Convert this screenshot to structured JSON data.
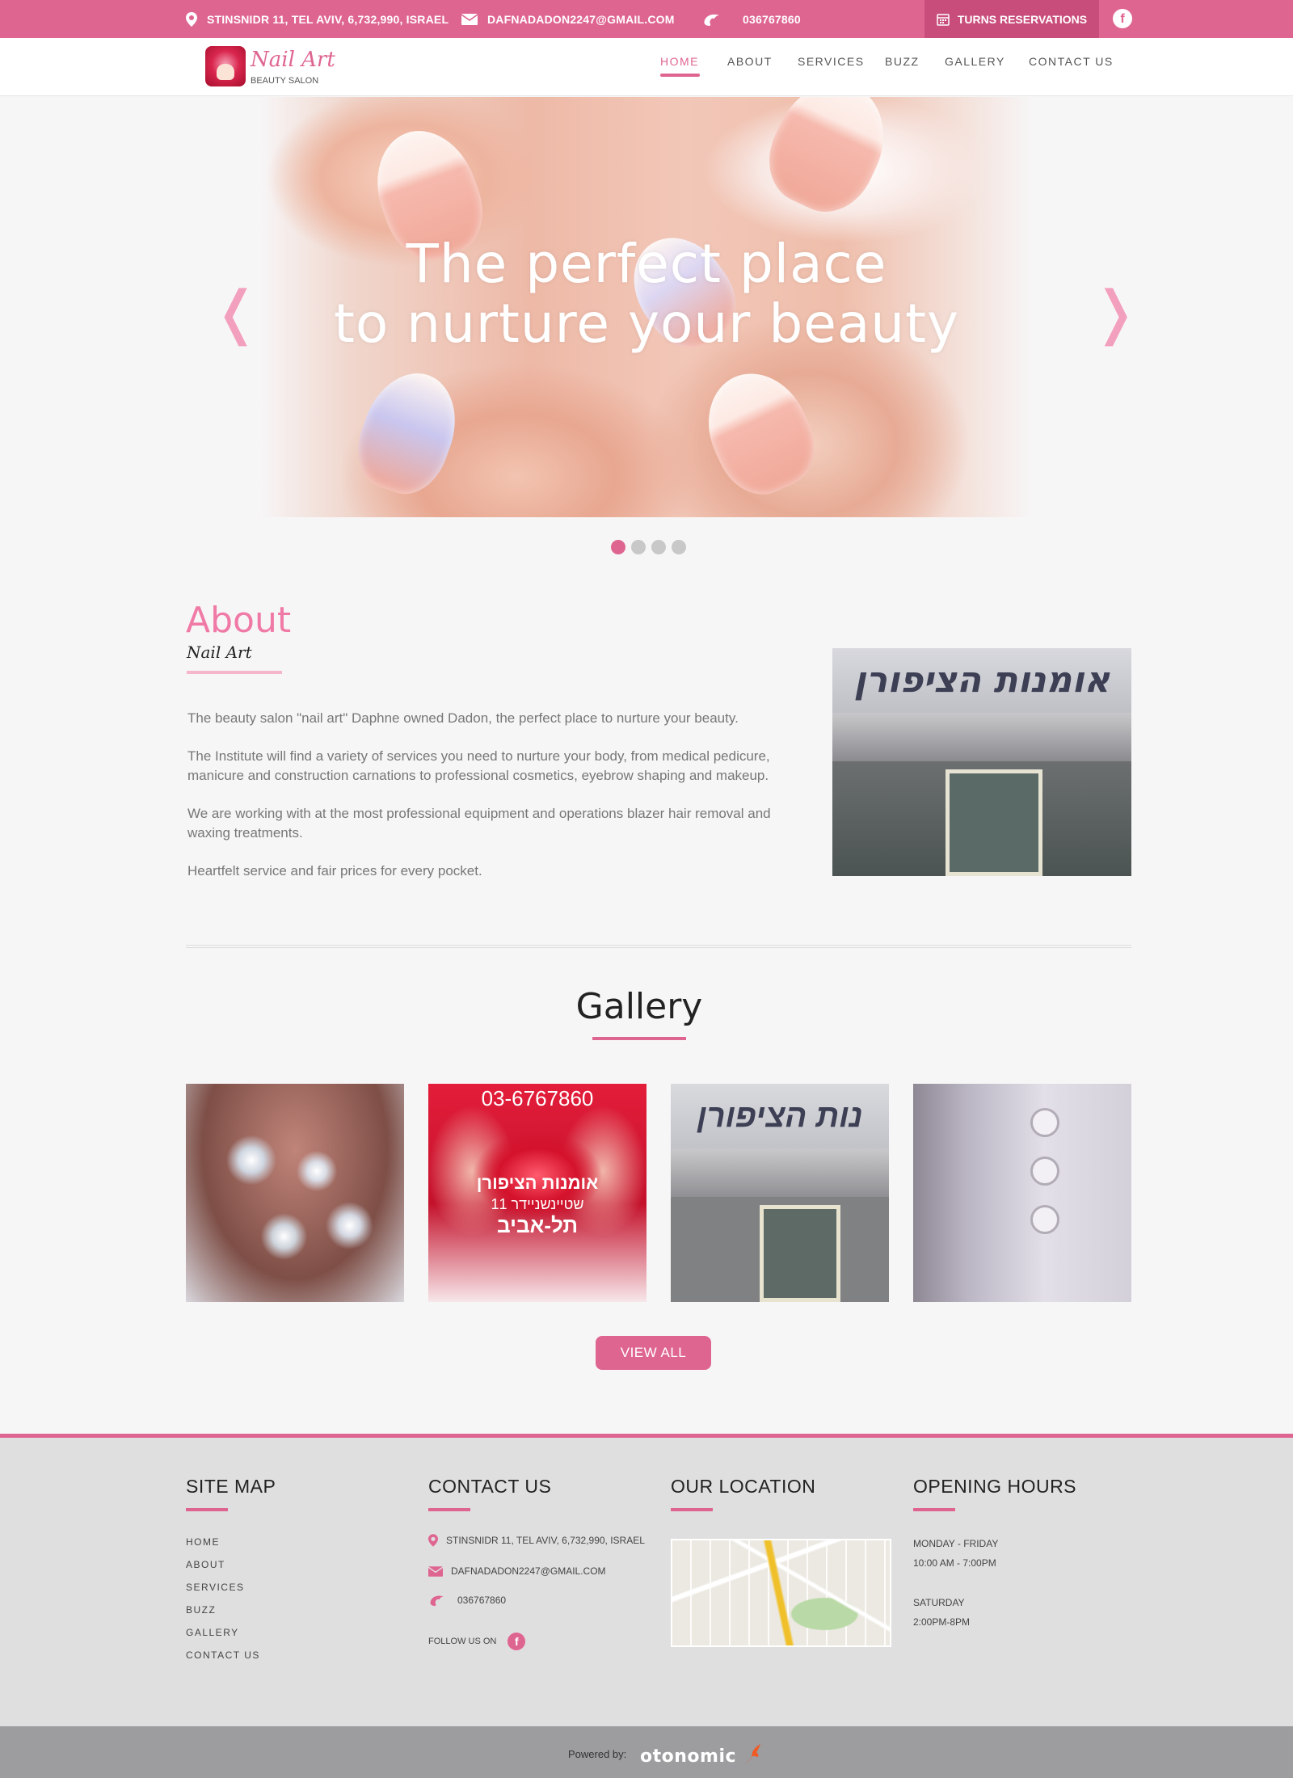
{
  "topbar": {
    "address": "STINSNIDR 11, TEL AVIV, 6,732,990, ISRAEL",
    "email": "DAFNADADON2247@GMAIL.COM",
    "phone": "036767860",
    "reserve_label": "TURNS RESERVATIONS",
    "facebook_glyph": "f"
  },
  "header": {
    "logo_name": "Nail Art",
    "logo_tag": "BEAUTY SALON",
    "nav": [
      "HOME",
      "ABOUT",
      "SERVICES",
      "BUZZ",
      "GALLERY",
      "CONTACT US"
    ],
    "active_nav": "HOME"
  },
  "hero": {
    "line1": "The perfect place",
    "line2": "to nurture your beauty",
    "prev_glyph": "❬",
    "next_glyph": "❭",
    "slide_count": 4,
    "active_slide": 1
  },
  "about": {
    "title": "About",
    "subtitle": "Nail Art",
    "paragraphs": [
      "The beauty salon \"nail art\" Daphne owned Dadon, the perfect place to nurture your beauty.",
      "The Institute will find a variety of services you need to nurture your body, from medical pedicure, manicure and construction carnations to professional cosmetics, eyebrow shaping and makeup.",
      "We are working with at the most professional equipment and operations blazer hair removal and waxing treatments.",
      "Heartfelt service and fair prices for every pocket."
    ],
    "store_sign": "אומנות הציפורן"
  },
  "gallery": {
    "title": "Gallery",
    "g2_phone": "03-6767860",
    "g2_heb1": "אומנות הציפורן",
    "g2_heb2": "שטיינשניידר 11",
    "g2_heb3": "תל-אביב",
    "g3_sign": "נות הציפורן",
    "view_all": "VIEW ALL"
  },
  "footer": {
    "sitemap_title": "SITE MAP",
    "sitemap_items": [
      "HOME",
      "ABOUT",
      "SERVICES",
      "BUZZ",
      "GALLERY",
      "CONTACT US"
    ],
    "contact_title": "CONTACT US",
    "contact_address": "STINSNIDR 11, TEL AVIV, 6,732,990, ISRAEL",
    "contact_email": "DAFNADADON2247@GMAIL.COM",
    "contact_phone": "036767860",
    "follow_label": "FOLLOW US ON",
    "location_title": "OUR LOCATION",
    "hours_title": "OPENING HOURS",
    "hours": [
      "MONDAY - FRIDAY",
      "10:00 AM - 7:00PM",
      "SATURDAY",
      "2:00PM-8PM"
    ]
  },
  "bottom": {
    "powered_label": "Powered by:",
    "brand": "otonomic"
  },
  "colors": {
    "accent": "#df6591",
    "accent_dark": "#c94d7b",
    "footer_bg": "#e0dfe0",
    "bottom_bg": "#9d9c9e"
  },
  "icons": [
    "map-pin-icon",
    "envelope-icon",
    "phone-icon",
    "calendar-icon",
    "facebook-icon",
    "chevron-left-icon",
    "chevron-right-icon"
  ]
}
